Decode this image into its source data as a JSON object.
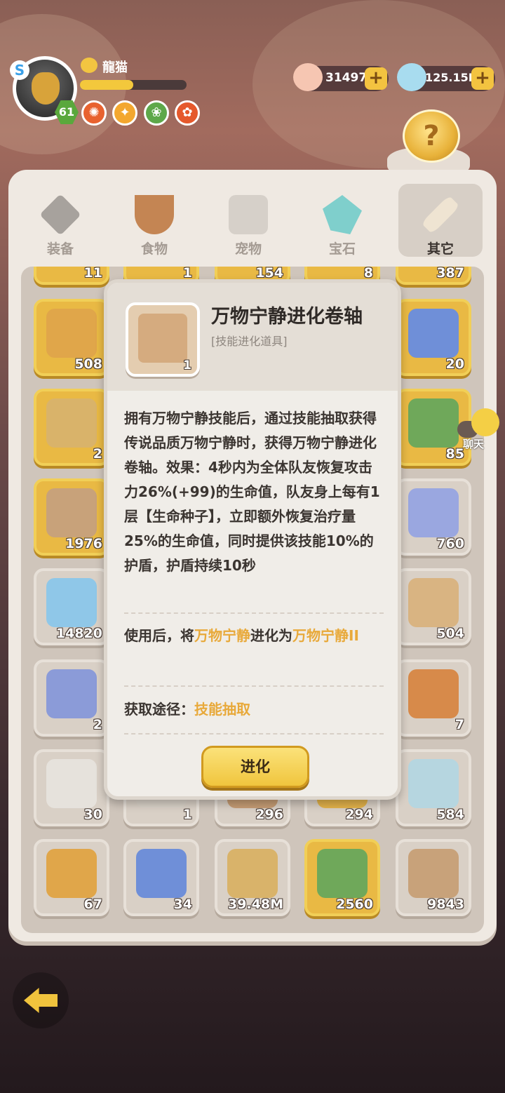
{
  "player": {
    "name": "龍猫",
    "level": "61",
    "xp_fraction": 0.5,
    "badge": "S"
  },
  "currencies": [
    {
      "name": "shell",
      "value": "31497",
      "color": "#f6b7a0"
    },
    {
      "name": "crystal",
      "value": "125.15M",
      "color": "#9fd6ee"
    }
  ],
  "tabs": [
    {
      "label": "装备",
      "icon": "hammer-icon",
      "active": false
    },
    {
      "label": "食物",
      "icon": "food-bowl-icon",
      "active": false
    },
    {
      "label": "宠物",
      "icon": "dino-skull-icon",
      "active": false
    },
    {
      "label": "宝石",
      "icon": "gem-icon",
      "active": false
    },
    {
      "label": "其它",
      "icon": "bone-icon",
      "active": true
    }
  ],
  "top_partial_counts": [
    "11",
    "1",
    "154",
    "8",
    "387"
  ],
  "grid_rows": [
    [
      {
        "count": "508",
        "gold": true
      },
      {
        "count": "20",
        "gold": true
      }
    ],
    [
      {
        "count": "2",
        "gold": true
      },
      {
        "count": "85",
        "gold": true
      }
    ],
    [
      {
        "count": "1976",
        "gold": true
      },
      {
        "count": "760",
        "gold": false
      }
    ],
    [
      {
        "count": "14820",
        "gold": false
      },
      {
        "count": "504",
        "gold": false
      }
    ],
    [
      {
        "count": "2",
        "gold": false
      },
      {
        "count": "7",
        "gold": false
      }
    ],
    [
      {
        "count": "30",
        "gold": false
      },
      {
        "count": "1",
        "gold": false
      },
      {
        "count": "296",
        "gold": false
      },
      {
        "count": "294",
        "gold": false
      },
      {
        "count": "584",
        "gold": false
      }
    ],
    [
      {
        "count": "67",
        "gold": false
      },
      {
        "count": "34",
        "gold": false
      },
      {
        "count": "39.48M",
        "gold": false
      },
      {
        "count": "2560",
        "gold": true
      },
      {
        "count": "9843",
        "gold": false
      }
    ]
  ],
  "popup": {
    "title": "万物宁静进化卷轴",
    "subtitle": "[技能进化道具]",
    "count": "1",
    "description": "拥有万物宁静技能后，通过技能抽取获得传说品质万物宁静时，获得万物宁静进化卷轴。效果：4秒内为全体队友恢复攻击力26%(+99)的生命值，队友身上每有1层【生命种子】，立即额外恢复治疗量25%的生命值，同时提供该技能10%的护盾，护盾持续10秒",
    "use_prefix": "使用后，将",
    "use_from": "万物宁静",
    "use_mid": "进化为",
    "use_to": "万物宁静II",
    "source_label": "获取途径：",
    "source_value": "技能抽取",
    "button": "进化"
  },
  "chat_label": "聊天",
  "colors": {
    "gold": "#f0c33d",
    "highlight": "#e8a93a",
    "panel": "#efe9e2"
  }
}
